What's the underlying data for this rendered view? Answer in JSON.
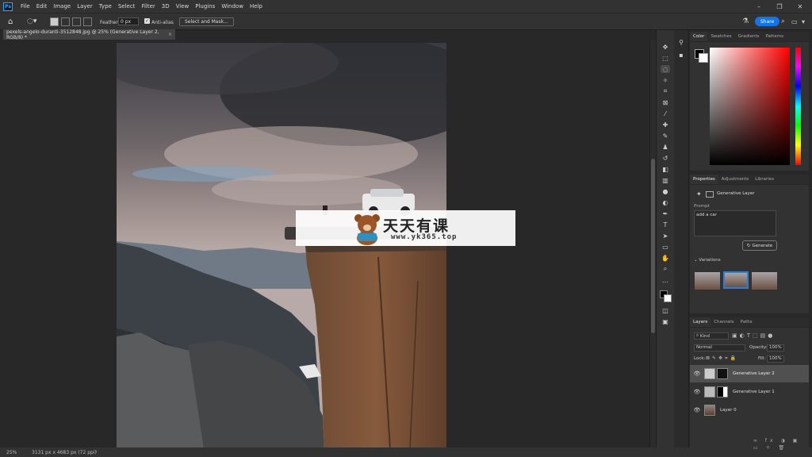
{
  "app": {
    "logo": "Ps"
  },
  "menu": [
    "File",
    "Edit",
    "Image",
    "Layer",
    "Type",
    "Select",
    "Filter",
    "3D",
    "View",
    "Plugins",
    "Window",
    "Help"
  ],
  "options": {
    "feather_label": "Feather:",
    "feather_value": "0 px",
    "antialias_label": "Anti-alias",
    "select_mask_label": "Select and Mask...",
    "share_label": "Share"
  },
  "document": {
    "tab_title": "pexels-angelo-duranti-3512848.jpg @ 25% (Generative Layer 2, RGB/8) *",
    "close": "×"
  },
  "status": {
    "zoom": "25%",
    "dimensions": "3131 px x 4683 px (72 ppi)",
    "arrow": "›"
  },
  "color_panel": {
    "tabs": [
      "Color",
      "Swatches",
      "Gradients",
      "Patterns"
    ],
    "foreground": "#000000",
    "background": "#ffffff"
  },
  "properties": {
    "tabs": [
      "Properties",
      "Adjustments",
      "Libraries"
    ],
    "layer_type": "Generative Layer",
    "prompt_label": "Prompt",
    "prompt_value": "add a car",
    "generate_label": "Generate",
    "variations_label": "Variations"
  },
  "layers": {
    "tabs": [
      "Layers",
      "Channels",
      "Paths"
    ],
    "filter_label": "Kind",
    "blend_mode": "Normal",
    "opacity_label": "Opacity:",
    "opacity_value": "100%",
    "lock_label": "Lock:",
    "fill_label": "Fill:",
    "fill_value": "100%",
    "items": [
      {
        "name": "Generative Layer 2"
      },
      {
        "name": "Generative Layer 1"
      },
      {
        "name": "Layer 0"
      }
    ]
  },
  "watermark": {
    "title": "天天有课",
    "url": "www.yk365.top"
  },
  "colors": {
    "accent": "#1473e6",
    "panel": "#323232",
    "canvas": "#282828"
  }
}
